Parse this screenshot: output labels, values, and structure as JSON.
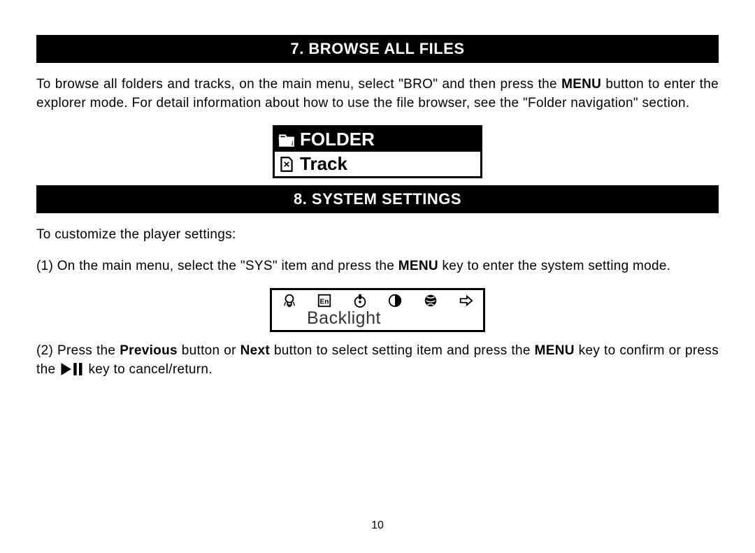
{
  "section7": {
    "title": "7. BROWSE ALL FILES",
    "para1_a": "To browse all folders and tracks, on the main menu, select \"BRO\" and then press the ",
    "para1_menu": "MENU",
    "para1_b": " button to enter the explorer mode. For detail information about how to use the file browser, see the \"Folder navigation\" section.",
    "figure": {
      "row1_label": "FOLDER",
      "row2_label": "Track"
    }
  },
  "section8": {
    "title": "8. SYSTEM SETTINGS",
    "intro": "To customize the player settings:",
    "step1_a": "(1) On the main menu, select the \"SYS\" item and press the ",
    "step1_menu": "MENU",
    "step1_b": " key to enter the system setting mode.",
    "figure_label": "Backlight",
    "step2_a": "(2) Press the ",
    "step2_prev": "Previous",
    "step2_b": " button or ",
    "step2_next": "Next",
    "step2_c": " button to select setting item and press the ",
    "step2_menu": "MENU",
    "step2_d": " key to confirm or press the ",
    "step2_e": " key to cancel/return."
  },
  "page_number": "10"
}
